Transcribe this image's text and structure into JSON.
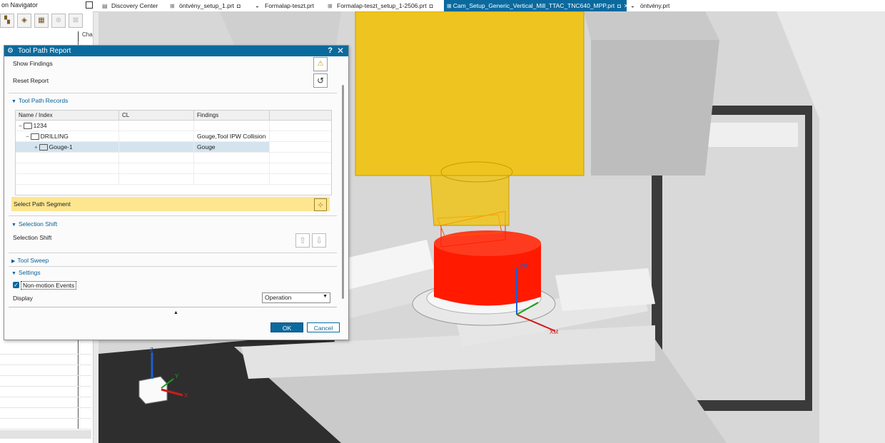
{
  "navigator": {
    "title": "on Navigator",
    "column_header": "Cha"
  },
  "tabs": [
    {
      "label": "Discovery Center",
      "icon": "book-icon",
      "active": false
    },
    {
      "label": "öntvény_setup_1.prt",
      "icon": "cam-part-icon",
      "active": false
    },
    {
      "label": "Formalap-teszt.prt",
      "icon": "part-icon",
      "active": false
    },
    {
      "label": "Formalap-teszt_setup_1-2506.prt",
      "icon": "cam-part-icon",
      "active": false
    },
    {
      "label": "Cam_Setup_Generic_Vertical_Mill_TTAC_TNC640_MPP.prt",
      "icon": "cam-part-icon",
      "active": true
    },
    {
      "label": "öntvény.prt",
      "icon": "part-icon",
      "active": false
    }
  ],
  "dialog": {
    "title": "Tool Path Report",
    "help": "?",
    "close": "✕",
    "show_findings": "Show Findings",
    "reset_report": "Reset Report",
    "records_header": "Tool Path Records",
    "columns": [
      "Name / Index",
      "CL",
      "Findings"
    ],
    "rows": [
      {
        "name": "1234",
        "cl": "",
        "findings": "",
        "indent": 0,
        "toggle": "−"
      },
      {
        "name": "DRILLING",
        "cl": "",
        "findings": "Gouge,Tool IPW Collision",
        "indent": 1,
        "toggle": "−"
      },
      {
        "name": "Gouge-1",
        "cl": "",
        "findings": "Gouge",
        "indent": 2,
        "toggle": "+"
      }
    ],
    "select_path_segment": "Select Path Segment",
    "selection_shift_header": "Selection Shift",
    "selection_shift_label": "Selection Shift",
    "tool_sweep_header": "Tool Sweep",
    "settings_header": "Settings",
    "non_motion_events": "Non-motion Events",
    "non_motion_checked": true,
    "display_label": "Display",
    "display_value": "Operation",
    "ok": "OK",
    "cancel": "Cancel"
  },
  "viewport": {
    "csys_labels": {
      "zm": "ZM",
      "xm": "XM",
      "z": "Z",
      "y": "Y",
      "x": "X"
    }
  },
  "colors": {
    "accent": "#0a6a9e",
    "tool_holder": "#f2c200",
    "collision": "#ff0000",
    "highlight": "#fde68f"
  }
}
